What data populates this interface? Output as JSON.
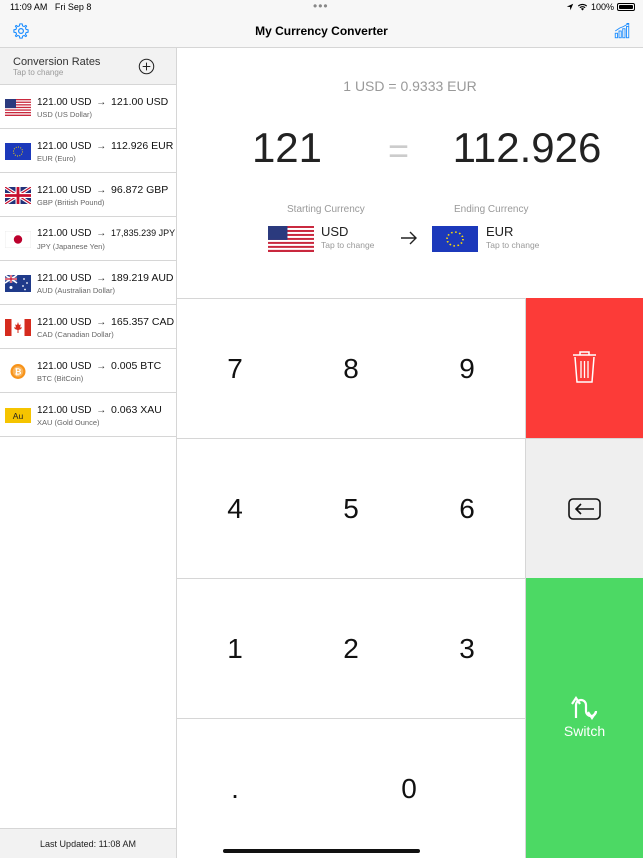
{
  "status": {
    "time": "11:09 AM",
    "date": "Fri Sep 8",
    "battery": "100%"
  },
  "navbar": {
    "title": "My Currency Converter",
    "settings_icon": "gear-icon",
    "chart_icon": "chart-icon"
  },
  "sidebar": {
    "title": "Conversion Rates",
    "subtitle": "Tap to change",
    "footer": "Last Updated: 11:08 AM",
    "items": [
      {
        "from": "121.00 USD",
        "to": "121.00 USD",
        "name": "USD (US Dollar)",
        "flag": "us"
      },
      {
        "from": "121.00 USD",
        "to": "112.926 EUR",
        "name": "EUR (Euro)",
        "flag": "eu"
      },
      {
        "from": "121.00 USD",
        "to": "96.872 GBP",
        "name": "GBP (British Pound)",
        "flag": "gb"
      },
      {
        "from": "121.00 USD",
        "to": "17,835.239 JPY",
        "name": "JPY (Japanese Yen)",
        "flag": "jp"
      },
      {
        "from": "121.00 USD",
        "to": "189.219 AUD",
        "name": "AUD (Australian Dollar)",
        "flag": "au"
      },
      {
        "from": "121.00 USD",
        "to": "165.357 CAD",
        "name": "CAD (Canadian Dollar)",
        "flag": "ca"
      },
      {
        "from": "121.00 USD",
        "to": "0.005 BTC",
        "name": "BTC (BitCoin)",
        "flag": "btc"
      },
      {
        "from": "121.00 USD",
        "to": "0.063 XAU",
        "name": "XAU (Gold Ounce)",
        "flag": "xau"
      }
    ]
  },
  "converter": {
    "rate": "1 USD = 0.9333 EUR",
    "from_amount": "121",
    "equals": "=",
    "to_amount": "112.926",
    "start_label": "Starting Currency",
    "end_label": "Ending Currency",
    "start_code": "USD",
    "end_code": "EUR",
    "tap_to_change": "Tap to change"
  },
  "keypad": {
    "keys": [
      "7",
      "8",
      "9",
      "4",
      "5",
      "6",
      "1",
      "2",
      "3",
      ".",
      "0"
    ],
    "switch_label": "Switch",
    "flag_xau_text": "Au",
    "colors": {
      "clear": "#fc3b38",
      "back": "#efefef",
      "switch": "#4cd964"
    }
  }
}
